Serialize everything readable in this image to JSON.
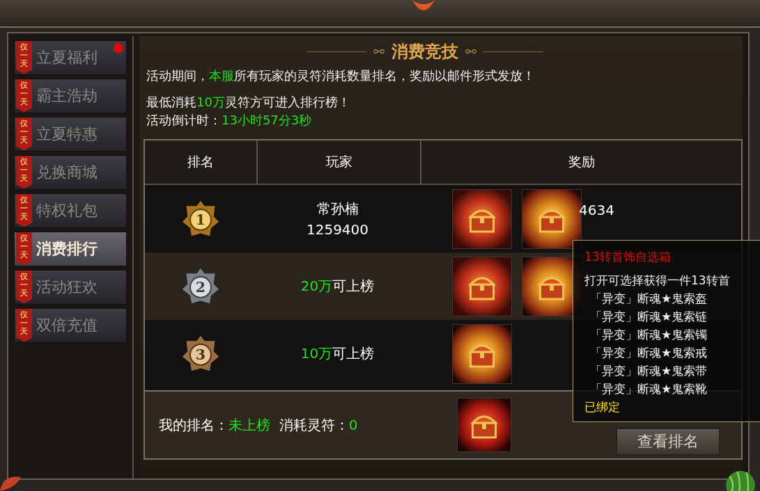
{
  "sidebar": {
    "items": [
      {
        "tag": "仅一天",
        "label": "立夏福利",
        "selected": false,
        "dot": true
      },
      {
        "tag": "仅一天",
        "label": "霸主浩劫",
        "selected": false,
        "dot": false
      },
      {
        "tag": "仅一天",
        "label": "立夏特惠",
        "selected": false,
        "dot": false
      },
      {
        "tag": "仅一天",
        "label": "兑换商城",
        "selected": false,
        "dot": false
      },
      {
        "tag": "仅一天",
        "label": "特权礼包",
        "selected": false,
        "dot": false
      },
      {
        "tag": "仅一天",
        "label": "消费排行",
        "selected": true,
        "dot": false
      },
      {
        "tag": "仅一天",
        "label": "活动狂欢",
        "selected": false,
        "dot": false
      },
      {
        "tag": "仅一天",
        "label": "双倍充值",
        "selected": false,
        "dot": false
      }
    ]
  },
  "title": "消费竞技",
  "intro": [
    [
      {
        "text": "活动期间，",
        "highlight": false
      },
      {
        "text": "本服",
        "highlight": true
      },
      {
        "text": "所有玩家的灵符消耗数量排名，奖励以邮件形式发放！",
        "highlight": false
      }
    ],
    [
      {
        "text": "最低消耗",
        "highlight": false
      },
      {
        "text": "10万",
        "highlight": true
      },
      {
        "text": "灵符方可进入排行榜！",
        "highlight": false
      }
    ],
    [
      {
        "text": "活动倒计时：",
        "highlight": false
      },
      {
        "text": "13小时57分3秒",
        "highlight": true
      }
    ]
  ],
  "table": {
    "columns": [
      "排名",
      "玩家",
      "奖励"
    ],
    "rows": [
      {
        "rank": "1",
        "kind": "gold",
        "player": [
          {
            "text": "常孙楠",
            "highlight": false
          }
        ],
        "score": "1259400",
        "rewards": [
          {
            "kind": "dragon"
          },
          {
            "kind": "glow"
          }
        ],
        "count": "4634"
      },
      {
        "rank": "2",
        "kind": "silver",
        "player": [
          {
            "text": "20万",
            "highlight": true
          },
          {
            "text": "可上榜",
            "highlight": false
          }
        ],
        "rewards": [
          {
            "kind": "dragon"
          },
          {
            "kind": "glow"
          }
        ]
      },
      {
        "rank": "3",
        "kind": "bronze",
        "player": [
          {
            "text": "10万",
            "highlight": true
          },
          {
            "text": "可上榜",
            "highlight": false
          }
        ],
        "rewards": [
          {
            "kind": "glow"
          }
        ]
      }
    ]
  },
  "footer": {
    "rank_label": "我的排名：",
    "rank_value": "未上榜",
    "spent_label": "消耗灵符：",
    "spent_value": "0",
    "reward": {
      "kind": "red"
    },
    "button": "查看排名"
  },
  "tooltip": {
    "title": "13转首饰自选箱",
    "description": "打开可选择获得一件13转首",
    "items": [
      "「异变」断魂★鬼索盔",
      "「异变」断魂★鬼索链",
      "「异变」断魂★鬼索镯",
      "「异变」断魂★鬼索戒",
      "「异变」断魂★鬼索带",
      "「异变」断魂★鬼索靴"
    ],
    "status": "已绑定"
  }
}
